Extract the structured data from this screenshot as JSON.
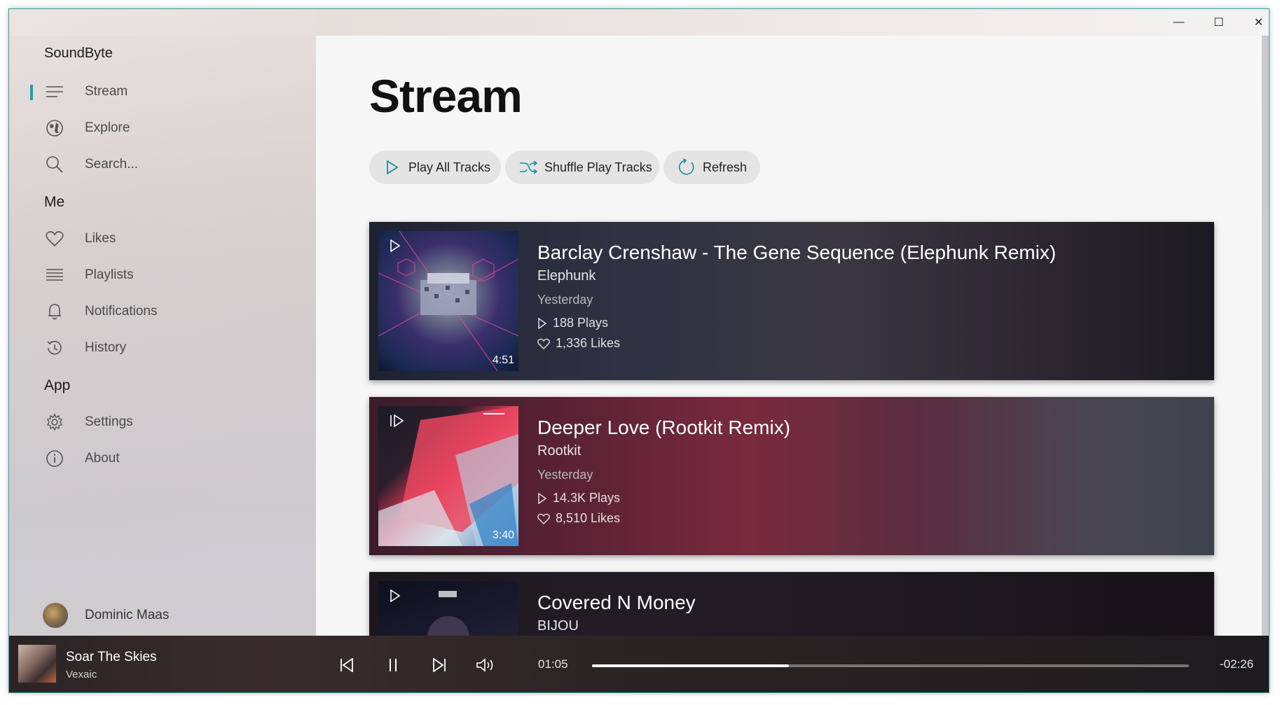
{
  "app": {
    "name": "SoundByte",
    "window_controls": {
      "minimize": "—",
      "maximize": "☐",
      "close": "✕"
    }
  },
  "sidebar": {
    "top_items": [
      {
        "label": "Stream",
        "icon": "stream-lines-icon",
        "active": true
      },
      {
        "label": "Explore",
        "icon": "globe-icon"
      },
      {
        "label": "Search...",
        "icon": "search-icon"
      }
    ],
    "me_header": "Me",
    "me_items": [
      {
        "label": "Likes",
        "icon": "heart-icon"
      },
      {
        "label": "Playlists",
        "icon": "list-icon"
      },
      {
        "label": "Notifications",
        "icon": "bell-icon"
      },
      {
        "label": "History",
        "icon": "history-icon"
      }
    ],
    "app_header": "App",
    "app_items": [
      {
        "label": "Settings",
        "icon": "gear-icon"
      },
      {
        "label": "About",
        "icon": "info-icon"
      }
    ],
    "user": {
      "name": "Dominic Maas"
    },
    "accent": "#1aa4a8"
  },
  "main": {
    "title": "Stream",
    "actions": [
      {
        "label": "Play All Tracks",
        "icon": "play-icon"
      },
      {
        "label": "Shuffle Play Tracks",
        "icon": "shuffle-icon"
      },
      {
        "label": "Refresh",
        "icon": "refresh-icon"
      }
    ],
    "tracks": [
      {
        "title": "Barclay Crenshaw - The Gene Sequence (Elephunk Remix)",
        "artist": "Elephunk",
        "date": "Yesterday",
        "plays": "188 Plays",
        "likes": "1,336 Likes",
        "duration": "4:51",
        "color": "#2b2f3d"
      },
      {
        "title": "Deeper Love (Rootkit Remix)",
        "artist": "Rootkit",
        "date": "Yesterday",
        "plays": "14.3K Plays",
        "likes": "8,510 Likes",
        "duration": "3:40",
        "color": "#6a2236"
      },
      {
        "title": "Covered N Money",
        "artist": "BIJOU",
        "date": "",
        "plays": "",
        "likes": "",
        "duration": "",
        "color": "#221c24"
      }
    ]
  },
  "player": {
    "title": "Soar The Skies",
    "artist": "Vexaic",
    "elapsed": "01:05",
    "remaining": "-02:26",
    "progress": 0.33
  }
}
